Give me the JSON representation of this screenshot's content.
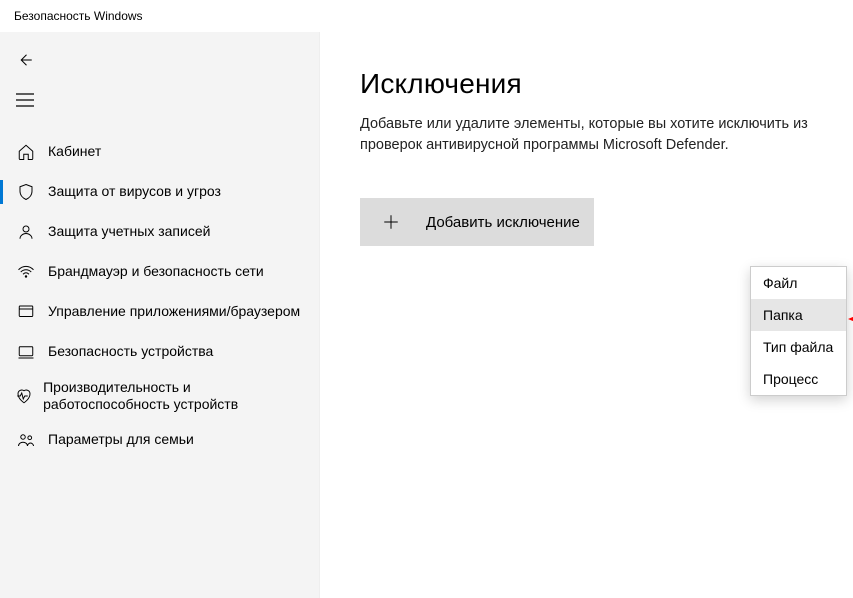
{
  "window_title": "Безопасность Windows",
  "sidebar": {
    "items": [
      {
        "label": "Кабинет"
      },
      {
        "label": "Защита от вирусов и угроз"
      },
      {
        "label": "Защита учетных записей"
      },
      {
        "label": "Брандмауэр и безопасность сети"
      },
      {
        "label": "Управление приложениями/браузером"
      },
      {
        "label": "Безопасность устройства"
      },
      {
        "label": "Производительность и работоспособность устройств"
      },
      {
        "label": "Параметры для семьи"
      }
    ]
  },
  "page": {
    "title": "Исключения",
    "description": "Добавьте или удалите элементы, которые вы хотите исключить из проверок антивирусной программы Microsoft Defender.",
    "add_button": "Добавить исключение"
  },
  "dropdown": {
    "items": [
      {
        "label": "Файл"
      },
      {
        "label": "Папка"
      },
      {
        "label": "Тип файла"
      },
      {
        "label": "Процесс"
      }
    ]
  }
}
